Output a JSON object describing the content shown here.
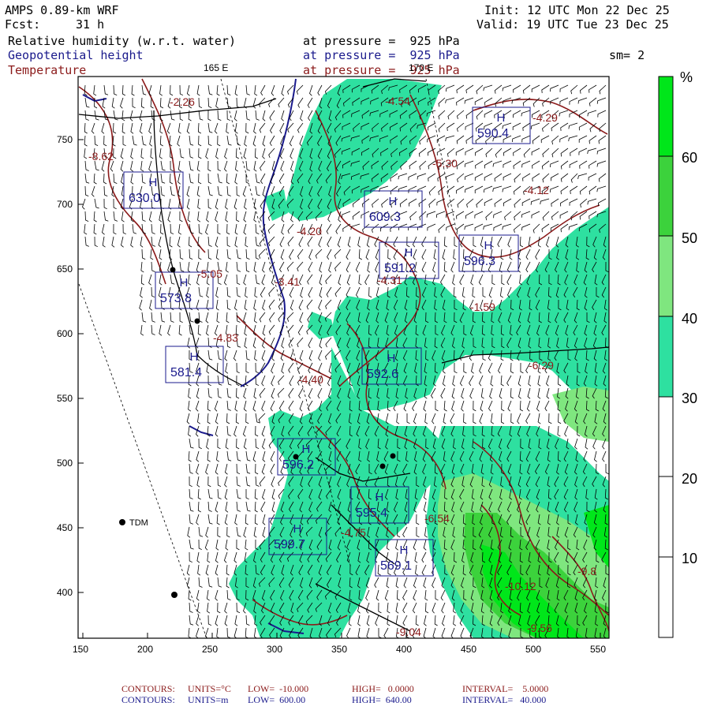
{
  "header": {
    "model": "AMPS 0.89-km WRF",
    "fcst_label": "Fcst:",
    "fcst_value": "31 h",
    "init": "Init: 12 UTC Mon 22 Dec 25",
    "valid": "Valid: 19 UTC Tue 23 Dec 25",
    "fields": [
      {
        "name": "Relative humidity (w.r.t. water)",
        "level": "at pressure =  925 hPa",
        "color": "#000000"
      },
      {
        "name": "Geopotential height",
        "level": "at pressure =  925 hPa",
        "color": "#1a1a8c"
      },
      {
        "name": "Temperature",
        "level": "at pressure =  925 hPa",
        "color": "#8b1a1a"
      }
    ],
    "smoothing": "sm= 2"
  },
  "map": {
    "meridian_labels": [
      "165 E",
      "170 E"
    ],
    "x_ticks": [
      "150",
      "200",
      "250",
      "300",
      "350",
      "400",
      "450",
      "500",
      "550"
    ],
    "y_ticks": [
      "750",
      "700",
      "650",
      "600",
      "550",
      "500",
      "450",
      "400"
    ],
    "station_label": "TDM",
    "height_highs": [
      {
        "mark": "H",
        "value": "590.4"
      },
      {
        "mark": "H",
        "value": "630.0"
      },
      {
        "mark": "H",
        "value": "609.3"
      },
      {
        "mark": "H",
        "value": "591.2"
      },
      {
        "mark": "H",
        "value": "596.3"
      },
      {
        "mark": "H",
        "value": "573.8"
      },
      {
        "mark": "H",
        "value": "581.4"
      },
      {
        "mark": "H",
        "value": "592.6"
      },
      {
        "mark": "H",
        "value": "596.2"
      },
      {
        "mark": "H",
        "value": "595.4"
      },
      {
        "mark": "H",
        "value": "599.7"
      },
      {
        "mark": "H",
        "value": "569.1"
      }
    ],
    "temperature_labels": [
      "-2.26",
      "-4.54",
      "-4.29",
      "-8.62",
      "-5.30",
      "-4.12",
      "-4.20",
      "-4.31",
      "-5.05",
      "-3.41",
      "-1.59",
      "-4.83",
      "-4.40",
      "-6.29",
      "-6.54",
      "-4.75",
      "-9.8",
      "-10.12",
      "-9.56",
      "-9.04"
    ],
    "colors": {
      "land_contour": "#000000",
      "height_contour": "#1a1a8c",
      "temperature_contour": "#8b1a1a",
      "frame": "#000000"
    }
  },
  "colorbar": {
    "unit": "%",
    "labels": [
      "60",
      "50",
      "40",
      "30",
      "20",
      "10"
    ],
    "bands": [
      {
        "range": "60-70",
        "color": "#00e61a"
      },
      {
        "range": "50-60",
        "color": "#3cd23c"
      },
      {
        "range": "40-50",
        "color": "#7fe67f"
      },
      {
        "range": "30-40",
        "color": "#2ee0a0"
      },
      {
        "range": "20-30",
        "color": "#ffffff"
      },
      {
        "range": "10-20",
        "color": "#ffffff"
      },
      {
        "range": "0-10",
        "color": "#ffffff"
      }
    ]
  },
  "footer": [
    {
      "label": "CONTOURS:",
      "units": "UNITS=°C",
      "low": "LOW=  -10.000",
      "high": "HIGH=   0.0000",
      "interval": "INTERVAL=    5.0000",
      "color": "#8b1a1a"
    },
    {
      "label": "CONTOURS:",
      "units": "UNITS=m",
      "low": "LOW=  600.00",
      "high": "HIGH=  640.00",
      "interval": "INTERVAL=   40.000",
      "color": "#1a1a8c"
    }
  ]
}
